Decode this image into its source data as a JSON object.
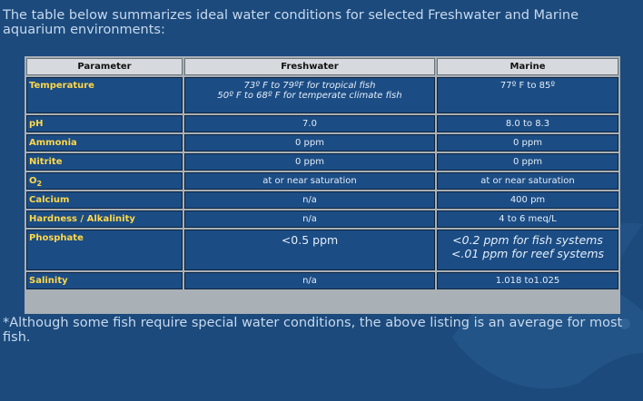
{
  "intro": "The table below summarizes ideal water conditions for selected Freshwater and Marine aquarium environments:",
  "table": {
    "headers": [
      "Parameter",
      "Freshwater",
      "Marine"
    ],
    "rows": [
      {
        "param": "Temperature",
        "fresh_line1": "73º F to 79ºF for tropical fish",
        "fresh_line2": "50º F to 68º F for temperate climate fish",
        "marine_line1": "77º  F to 85º",
        "marine_line2": ""
      },
      {
        "param": "pH",
        "fresh_line1": "7.0",
        "fresh_line2": "",
        "marine_line1": "8.0  to 8.3",
        "marine_line2": ""
      },
      {
        "param": "Ammonia",
        "fresh_line1": "0  ppm",
        "fresh_line2": "",
        "marine_line1": "0  ppm",
        "marine_line2": ""
      },
      {
        "param": "Nitrite",
        "fresh_line1": "0  ppm",
        "fresh_line2": "",
        "marine_line1": "0  ppm",
        "marine_line2": ""
      },
      {
        "param": "O2",
        "fresh_line1": "at  or near saturation",
        "fresh_line2": "",
        "marine_line1": "at  or near saturation",
        "marine_line2": ""
      },
      {
        "param": "Calcium",
        "fresh_line1": "n/a",
        "fresh_line2": "",
        "marine_line1": "400  pm",
        "marine_line2": ""
      },
      {
        "param": "Hardness  / Alkalinity",
        "fresh_line1": "n/a",
        "fresh_line2": "",
        "marine_line1": "4  to 6 meq/L",
        "marine_line2": ""
      },
      {
        "param": "Phosphate",
        "fresh_line1": "<0.5 ppm",
        "fresh_line2": "",
        "marine_line1": "<0.2 ppm for fish systems",
        "marine_line2": "<.01 ppm for reef systems"
      },
      {
        "param": "Salinity",
        "fresh_line1": "n/a",
        "fresh_line2": "",
        "marine_line1": "1.018  to1.025",
        "marine_line2": ""
      }
    ]
  },
  "note": "*Although some fish require special water conditions, the above listing is an average for most fish."
}
